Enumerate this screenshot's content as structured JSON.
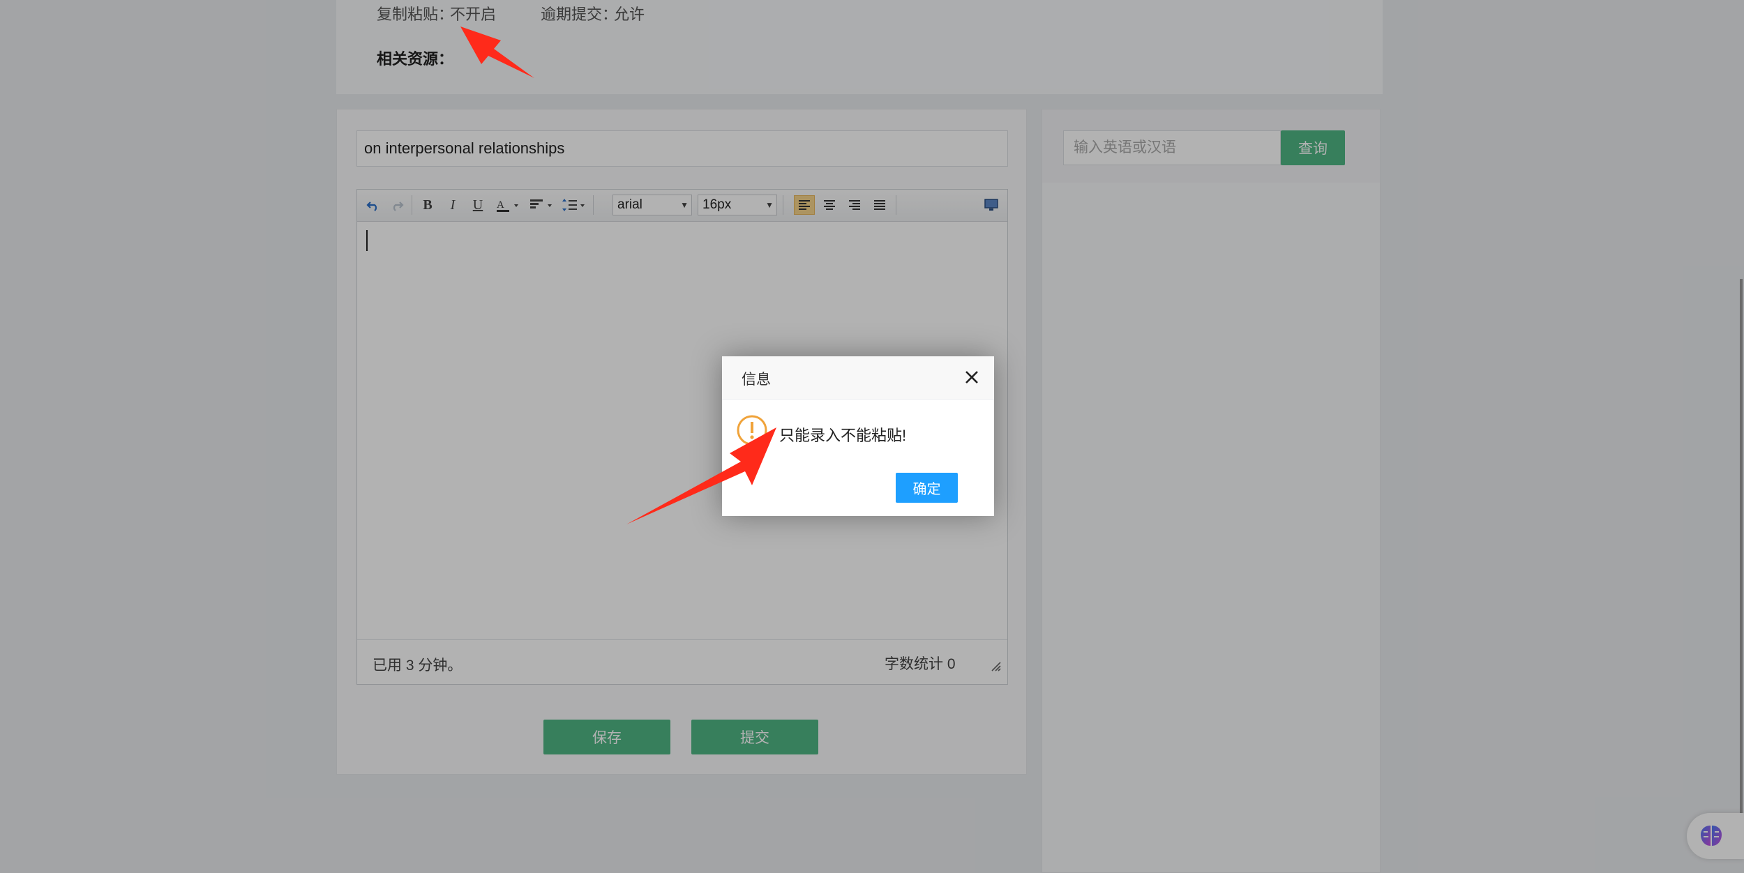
{
  "info": {
    "copy_paste_label": "复制粘贴：",
    "copy_paste_value": "不开启",
    "late_submit_label": "逾期提交：",
    "late_submit_value": "允许",
    "resources_label": "相关资源："
  },
  "essay": {
    "title_value": "on interpersonal relationships"
  },
  "toolbar": {
    "font_family": "arial",
    "font_size": "16px",
    "icons": [
      "undo-icon",
      "redo-icon",
      "bold-icon",
      "italic-icon",
      "underline-icon",
      "font-color-icon",
      "paragraph-format-icon",
      "line-height-icon",
      "align-left-icon",
      "align-center-icon",
      "align-right-icon",
      "align-justify-icon",
      "fullscreen-icon"
    ]
  },
  "editor_footer": {
    "elapsed_time": "已用 3 分钟。",
    "word_count": "字数统计 0"
  },
  "actions": {
    "save_label": "保存",
    "submit_label": "提交"
  },
  "dictionary": {
    "search_placeholder": "输入英语或汉语",
    "search_button": "查询"
  },
  "dialog": {
    "title": "信息",
    "message": "只能录入不能粘贴!",
    "ok_label": "确定"
  },
  "colors": {
    "primary_green": "#4fb784",
    "dialog_button_blue": "#1e9fff",
    "warning_orange": "#f0a33a",
    "annotation_arrow_red": "#ff2a1a"
  }
}
